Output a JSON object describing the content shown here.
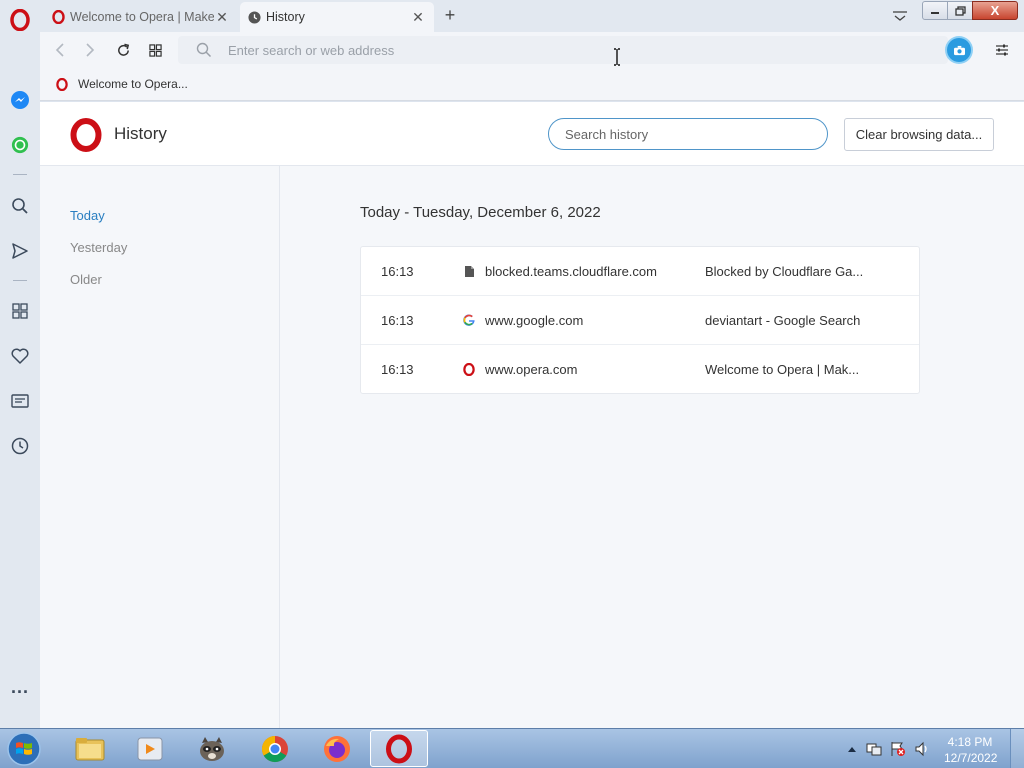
{
  "browser": {
    "tabs": [
      {
        "title": "Welcome to Opera | Make",
        "favicon": "opera-icon"
      },
      {
        "title": "History",
        "favicon": "clock-icon"
      }
    ],
    "new_tab_label": "+",
    "window_close_label": "X"
  },
  "address_bar": {
    "placeholder": "Enter search or web address",
    "value": ""
  },
  "bookmarks": [
    {
      "label": "Welcome to Opera...",
      "favicon": "opera-icon"
    }
  ],
  "sidebar": {
    "items": [
      "opera-logo-icon",
      "messenger-icon",
      "whatsapp-icon",
      "search-icon",
      "send-icon",
      "workspaces-icon",
      "heart-icon",
      "news-icon",
      "history-icon",
      "more-icon"
    ],
    "more_label": "..."
  },
  "history_page": {
    "title": "History",
    "search_placeholder": "Search history",
    "clear_button": "Clear browsing data...",
    "nav": [
      {
        "label": "Today",
        "active": true
      },
      {
        "label": "Yesterday",
        "active": false
      },
      {
        "label": "Older",
        "active": false
      }
    ],
    "day_heading": "Today - Tuesday, December 6, 2022",
    "entries": [
      {
        "time": "16:13",
        "icon": "document-icon",
        "domain": "blocked.teams.cloudflare.com",
        "title": "Blocked by Cloudflare Ga..."
      },
      {
        "time": "16:13",
        "icon": "google-icon",
        "domain": "www.google.com",
        "title": "deviantart - Google Search"
      },
      {
        "time": "16:13",
        "icon": "opera-icon",
        "domain": "www.opera.com",
        "title": "Welcome to Opera | Mak..."
      }
    ]
  },
  "taskbar": {
    "apps": [
      "explorer-icon",
      "media-player-icon",
      "raccoon-app-icon",
      "chrome-icon",
      "firefox-icon",
      "opera-icon"
    ],
    "clock_time": "4:18 PM",
    "clock_date": "12/7/2022"
  },
  "colors": {
    "accent": "#2a7fc1",
    "opera_red": "#cc0f16",
    "chrome_bg": "#e2e8f0"
  }
}
